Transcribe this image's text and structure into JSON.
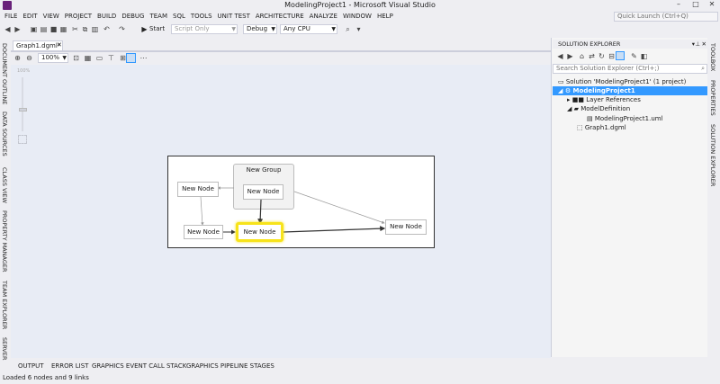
{
  "window": {
    "title": "ModelingProject1 - Microsoft Visual Studio",
    "quick_launch_placeholder": "Quick Launch (Ctrl+Q)"
  },
  "menu": [
    "FILE",
    "EDIT",
    "VIEW",
    "PROJECT",
    "BUILD",
    "DEBUG",
    "TEAM",
    "SQL",
    "TOOLS",
    "UNIT TEST",
    "ARCHITECTURE",
    "ANALYZE",
    "WINDOW",
    "HELP"
  ],
  "toolbar": {
    "start_label": "Start",
    "script_combo": "Script Only",
    "config_combo": "Debug",
    "platform_combo": "Any CPU"
  },
  "left_tabs": [
    "DOCUMENT OUTLINE",
    "DATA SOURCES",
    "CLASS VIEW",
    "PROPERTY MANAGER",
    "TEAM EXPLORER",
    "SERVER"
  ],
  "document": {
    "tab_label": "Graph1.dgml*",
    "zoom": "100%",
    "zoom_slider_label": "100%"
  },
  "graph": {
    "group_label": "New Group",
    "nodes": [
      "New Node",
      "New Node",
      "New Node",
      "New Node",
      "New Node"
    ],
    "highlight_color": "#f7e31a"
  },
  "solution_explorer": {
    "title": "SOLUTION EXPLORER",
    "search_placeholder": "Search Solution Explorer (Ctrl+;)",
    "items": [
      {
        "label": "Solution 'ModelingProject1' (1 project)",
        "level": 0
      },
      {
        "label": "ModelingProject1",
        "level": 1,
        "selected": true
      },
      {
        "label": "Layer References",
        "level": 2
      },
      {
        "label": "ModelDefinition",
        "level": 2
      },
      {
        "label": "ModelingProject1.uml",
        "level": 3
      },
      {
        "label": "Graph1.dgml",
        "level": 2
      }
    ],
    "selected_color": "#3399ff"
  },
  "right_tabs": [
    "TOOLBOX",
    "PROPERTIES",
    "SOLUTION EXPLORER"
  ],
  "bottom_tabs": [
    "OUTPUT",
    "ERROR LIST",
    "GRAPHICS EVENT CALL STACK",
    "GRAPHICS PIPELINE STAGES"
  ],
  "status": "Loaded 6 nodes and 9 links"
}
